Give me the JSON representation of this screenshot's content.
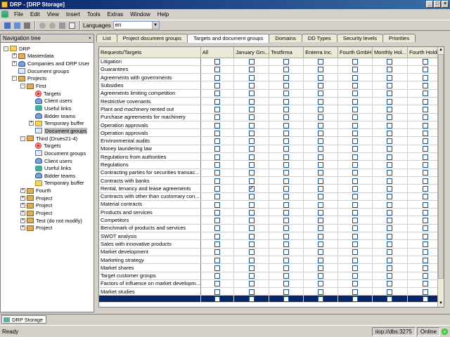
{
  "window": {
    "title": "DRP - [DRP Storage]"
  },
  "menu": [
    "File",
    "Edit",
    "View",
    "Insert",
    "Tools",
    "Extras",
    "Window",
    "Help"
  ],
  "toolbar": {
    "languages_label": "Languages",
    "language_value": "en"
  },
  "nav": {
    "title": "Navigation tree",
    "nodes": [
      {
        "label": "DRP",
        "icon": "folder-icon",
        "lvl": 0,
        "exp": "-"
      },
      {
        "label": "Masterdata",
        "icon": "box-icon",
        "lvl": 1,
        "exp": "+"
      },
      {
        "label": "Companies and DRP User",
        "icon": "people-icon",
        "lvl": 1,
        "exp": "+"
      },
      {
        "label": "Document groups",
        "icon": "doc-icon",
        "lvl": 1,
        "exp": ""
      },
      {
        "label": "Projects",
        "icon": "box-icon",
        "lvl": 1,
        "exp": "-"
      },
      {
        "label": "First",
        "icon": "box-icon",
        "lvl": 2,
        "exp": "-"
      },
      {
        "label": "Targets",
        "icon": "target-icon",
        "lvl": 3,
        "exp": ""
      },
      {
        "label": "Client users",
        "icon": "people-icon",
        "lvl": 3,
        "exp": ""
      },
      {
        "label": "Useful links",
        "icon": "link-icon",
        "lvl": 3,
        "exp": ""
      },
      {
        "label": "Bidder teams",
        "icon": "people-icon",
        "lvl": 3,
        "exp": ""
      },
      {
        "label": "Temporary buffer",
        "icon": "folder-icon",
        "lvl": 3,
        "exp": "+"
      },
      {
        "label": "Document groups",
        "icon": "doc-icon",
        "lvl": 3,
        "exp": "",
        "sel": true
      },
      {
        "label": "Third (Drues21-4)",
        "icon": "box-icon",
        "lvl": 2,
        "exp": "-"
      },
      {
        "label": "Targets",
        "icon": "target-icon",
        "lvl": 3,
        "exp": ""
      },
      {
        "label": "Document groups",
        "icon": "doc-icon",
        "lvl": 3,
        "exp": ""
      },
      {
        "label": "Client users",
        "icon": "people-icon",
        "lvl": 3,
        "exp": ""
      },
      {
        "label": "Useful links",
        "icon": "link-icon",
        "lvl": 3,
        "exp": ""
      },
      {
        "label": "Bidder teams",
        "icon": "people-icon",
        "lvl": 3,
        "exp": ""
      },
      {
        "label": "Temporary buffer",
        "icon": "folder-icon",
        "lvl": 3,
        "exp": ""
      },
      {
        "label": "Fourth",
        "icon": "box-icon",
        "lvl": 2,
        "exp": "+"
      },
      {
        "label": "Project",
        "icon": "box-icon",
        "lvl": 2,
        "exp": "+"
      },
      {
        "label": "Project",
        "icon": "box-icon",
        "lvl": 2,
        "exp": "+"
      },
      {
        "label": "Project",
        "icon": "box-icon",
        "lvl": 2,
        "exp": "+"
      },
      {
        "label": "Test (do not modify)",
        "icon": "box-icon",
        "lvl": 2,
        "exp": "+"
      },
      {
        "label": "Project",
        "icon": "box-icon",
        "lvl": 2,
        "exp": "+"
      }
    ]
  },
  "tabs": [
    "List",
    "Project document groups",
    "Targets and document groups",
    "Domains",
    "DD Types",
    "Security levels",
    "Priorities"
  ],
  "active_tab": 2,
  "grid": {
    "columns": [
      "Requests/Targets",
      "All",
      "January Gm...",
      "Testfirma",
      "Enterra Inc.",
      "Fourth GmbH",
      "Monthly Hol...",
      "Fourth Holdi..."
    ],
    "rows": [
      "Litigation",
      "Guarantees",
      "Agreements with governments",
      "Subsidies",
      "Agreements limiting competition",
      "Restrictive covenants",
      "Plant and machinery rented out",
      "Purchase agreements for machinery",
      "Operation approvals",
      "Operation approvals",
      "Environmental audits",
      "Money laundering law",
      "Regulations from authorities",
      "Regulations",
      "Contracting parties for securities transac...",
      "Contracts with banks",
      "Rental, tenancy and lease agreements",
      "Contracts with other than customary con...",
      "Material contracts",
      "Products and services",
      "Competitors",
      "Benchmark of products and services",
      "SWOT analysis",
      "Sales with innovative products",
      "Market development",
      "Marketing strategy",
      "Market shares",
      "Target customer groups",
      "Factors of influence on market developm...",
      "Market studies"
    ],
    "checked": [
      [
        16,
        2
      ]
    ]
  },
  "bottom_tab": "DRP Storage",
  "status": {
    "text": "Ready",
    "connection": "iiop://dbs:3275",
    "mode": "Online"
  }
}
